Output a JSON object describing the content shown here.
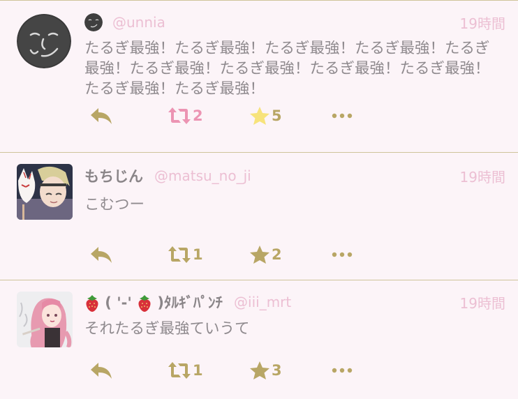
{
  "colors": {
    "background": "#fcf4f8",
    "divider": "#cfc49a",
    "action_gold": "#b8a665",
    "retweeted_pink": "#ec94b3",
    "favorited_star": "#f7e37b",
    "handle_pink": "#ecbfd3",
    "text_gray": "#8f8a8e"
  },
  "tweets": [
    {
      "display_name": "",
      "handle": "@unnia",
      "time": "19時間",
      "text": "たるぎ最強！たるぎ最強！たるぎ最強！たるぎ最強！たるぎ最強！たるぎ最強！たるぎ最強！たるぎ最強！たるぎ最強！たるぎ最強！たるぎ最強！",
      "retweets": "2",
      "retweeted": true,
      "favorites": "5",
      "favorited": true,
      "avatar_icon": "smiling-face-avatar"
    },
    {
      "display_name": "もちじん",
      "handle": "@matsu_no_ji",
      "time": "19時間",
      "text": "こむつー",
      "retweets": "1",
      "retweeted": false,
      "favorites": "2",
      "favorited": false,
      "avatar_icon": "fox-mask-boy-avatar"
    },
    {
      "display_name_parts": {
        "emoji1": "strawberry-icon",
        "face": " ( '-' ",
        "emoji2": "strawberry-icon",
        "suffix": " )ﾀﾙｷﾞﾊﾟﾝﾁ"
      },
      "handle": "@iii_mrt",
      "time": "19時間",
      "text": "それたるぎ最強ていうて",
      "retweets": "1",
      "retweeted": false,
      "favorites": "3",
      "favorited": false,
      "avatar_icon": "pink-hair-girl-avatar"
    }
  ]
}
